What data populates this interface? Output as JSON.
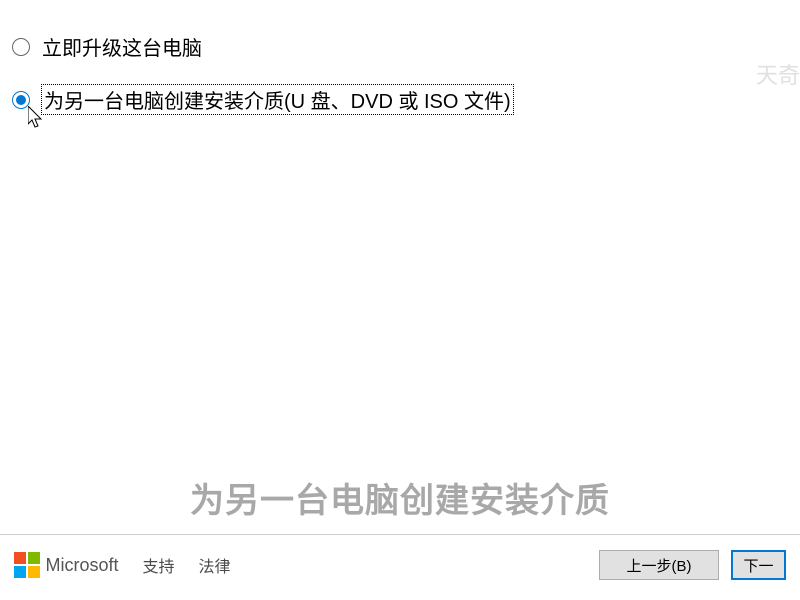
{
  "options": {
    "upgrade": "立即升级这台电脑",
    "create_media": "为另一台电脑创建安装介质(U 盘、DVD 或 ISO 文件)"
  },
  "footer": {
    "brand": "Microsoft",
    "support": "支持",
    "legal": "法律"
  },
  "buttons": {
    "back": "上一步(B)",
    "next": "下一"
  },
  "subtitle": "为另一台电脑创建安装介质",
  "watermark": "天奇"
}
